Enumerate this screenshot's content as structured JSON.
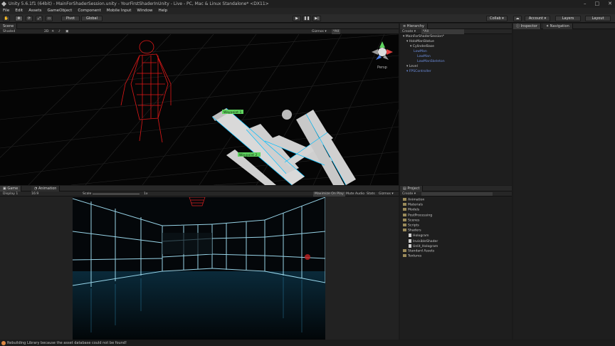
{
  "window": {
    "title": "Unity 5.6.1f1 (64bit) - MainForShaderSession.unity - YourFirstShaderInUnity - Live - PC, Mac & Linux Standalone* <DX11>",
    "controls": [
      "–",
      "□",
      "✕"
    ]
  },
  "menu": [
    "File",
    "Edit",
    "Assets",
    "GameObject",
    "Component",
    "Mobile Input",
    "Window",
    "Help"
  ],
  "toolbar": {
    "pivot": "Pivot",
    "global": "Global",
    "collab": "Collab ▾",
    "account": "Account ▾",
    "layers": "Layers",
    "layout": "Layout"
  },
  "scene": {
    "tab": "Scene",
    "shading": "Shaded",
    "mode": "2D",
    "gizmos": "Gizmos ▾",
    "search": "*All",
    "persp": "Persp",
    "waypoint1": "Waypoint 1",
    "waypoint2": "Waypoint 2"
  },
  "game": {
    "tabs": [
      "Game",
      "Animation"
    ],
    "display": "Display 1",
    "aspect": "16:9",
    "scale_label": "Scale",
    "scale_value": "1x",
    "options": [
      "Maximize On Play",
      "Mute Audio",
      "Stats",
      "Gizmos ▾"
    ]
  },
  "hierarchy": {
    "tab": "Hierarchy",
    "create": "Create ▾",
    "search": "*All",
    "items": [
      {
        "label": "MainForShaderSession*",
        "depth": 0,
        "blue": false
      },
      {
        "label": "HoloManStatue",
        "depth": 1,
        "blue": false
      },
      {
        "label": "CylinderBase",
        "depth": 2,
        "blue": false
      },
      {
        "label": "LowMan",
        "depth": 3,
        "blue": true
      },
      {
        "label": "LowMan",
        "depth": 4,
        "blue": true
      },
      {
        "label": "LowManSkeleton",
        "depth": 4,
        "blue": true
      },
      {
        "label": "Level",
        "depth": 1,
        "blue": false
      },
      {
        "label": "FPSController",
        "depth": 1,
        "blue": true
      }
    ]
  },
  "inspector": {
    "tabs": [
      "Inspector",
      "Navigation"
    ]
  },
  "project": {
    "tab": "Project",
    "create": "Create ▾",
    "items": [
      {
        "label": "Animation",
        "kind": "folder",
        "depth": 0
      },
      {
        "label": "Materials",
        "kind": "folder",
        "depth": 0
      },
      {
        "label": "Models",
        "kind": "folder",
        "depth": 0
      },
      {
        "label": "PostProcessing",
        "kind": "folder",
        "depth": 0
      },
      {
        "label": "Scenes",
        "kind": "folder",
        "depth": 0
      },
      {
        "label": "Scripts",
        "kind": "folder",
        "depth": 0
      },
      {
        "label": "Shaders",
        "kind": "folder",
        "depth": 0
      },
      {
        "label": "Hologram",
        "kind": "file",
        "depth": 1
      },
      {
        "label": "InvisibleShader",
        "kind": "file",
        "depth": 1
      },
      {
        "label": "Unlit_Hologram",
        "kind": "file",
        "depth": 1
      },
      {
        "label": "Standard Assets",
        "kind": "folder",
        "depth": 0
      },
      {
        "label": "Textures",
        "kind": "folder",
        "depth": 0
      }
    ]
  },
  "status": {
    "message": "Rebuilding Library because the asset database could not be found!"
  },
  "colors": {
    "accent": "#00cfff",
    "holo": "#ff2020",
    "waypoint": "#5fd35f"
  }
}
